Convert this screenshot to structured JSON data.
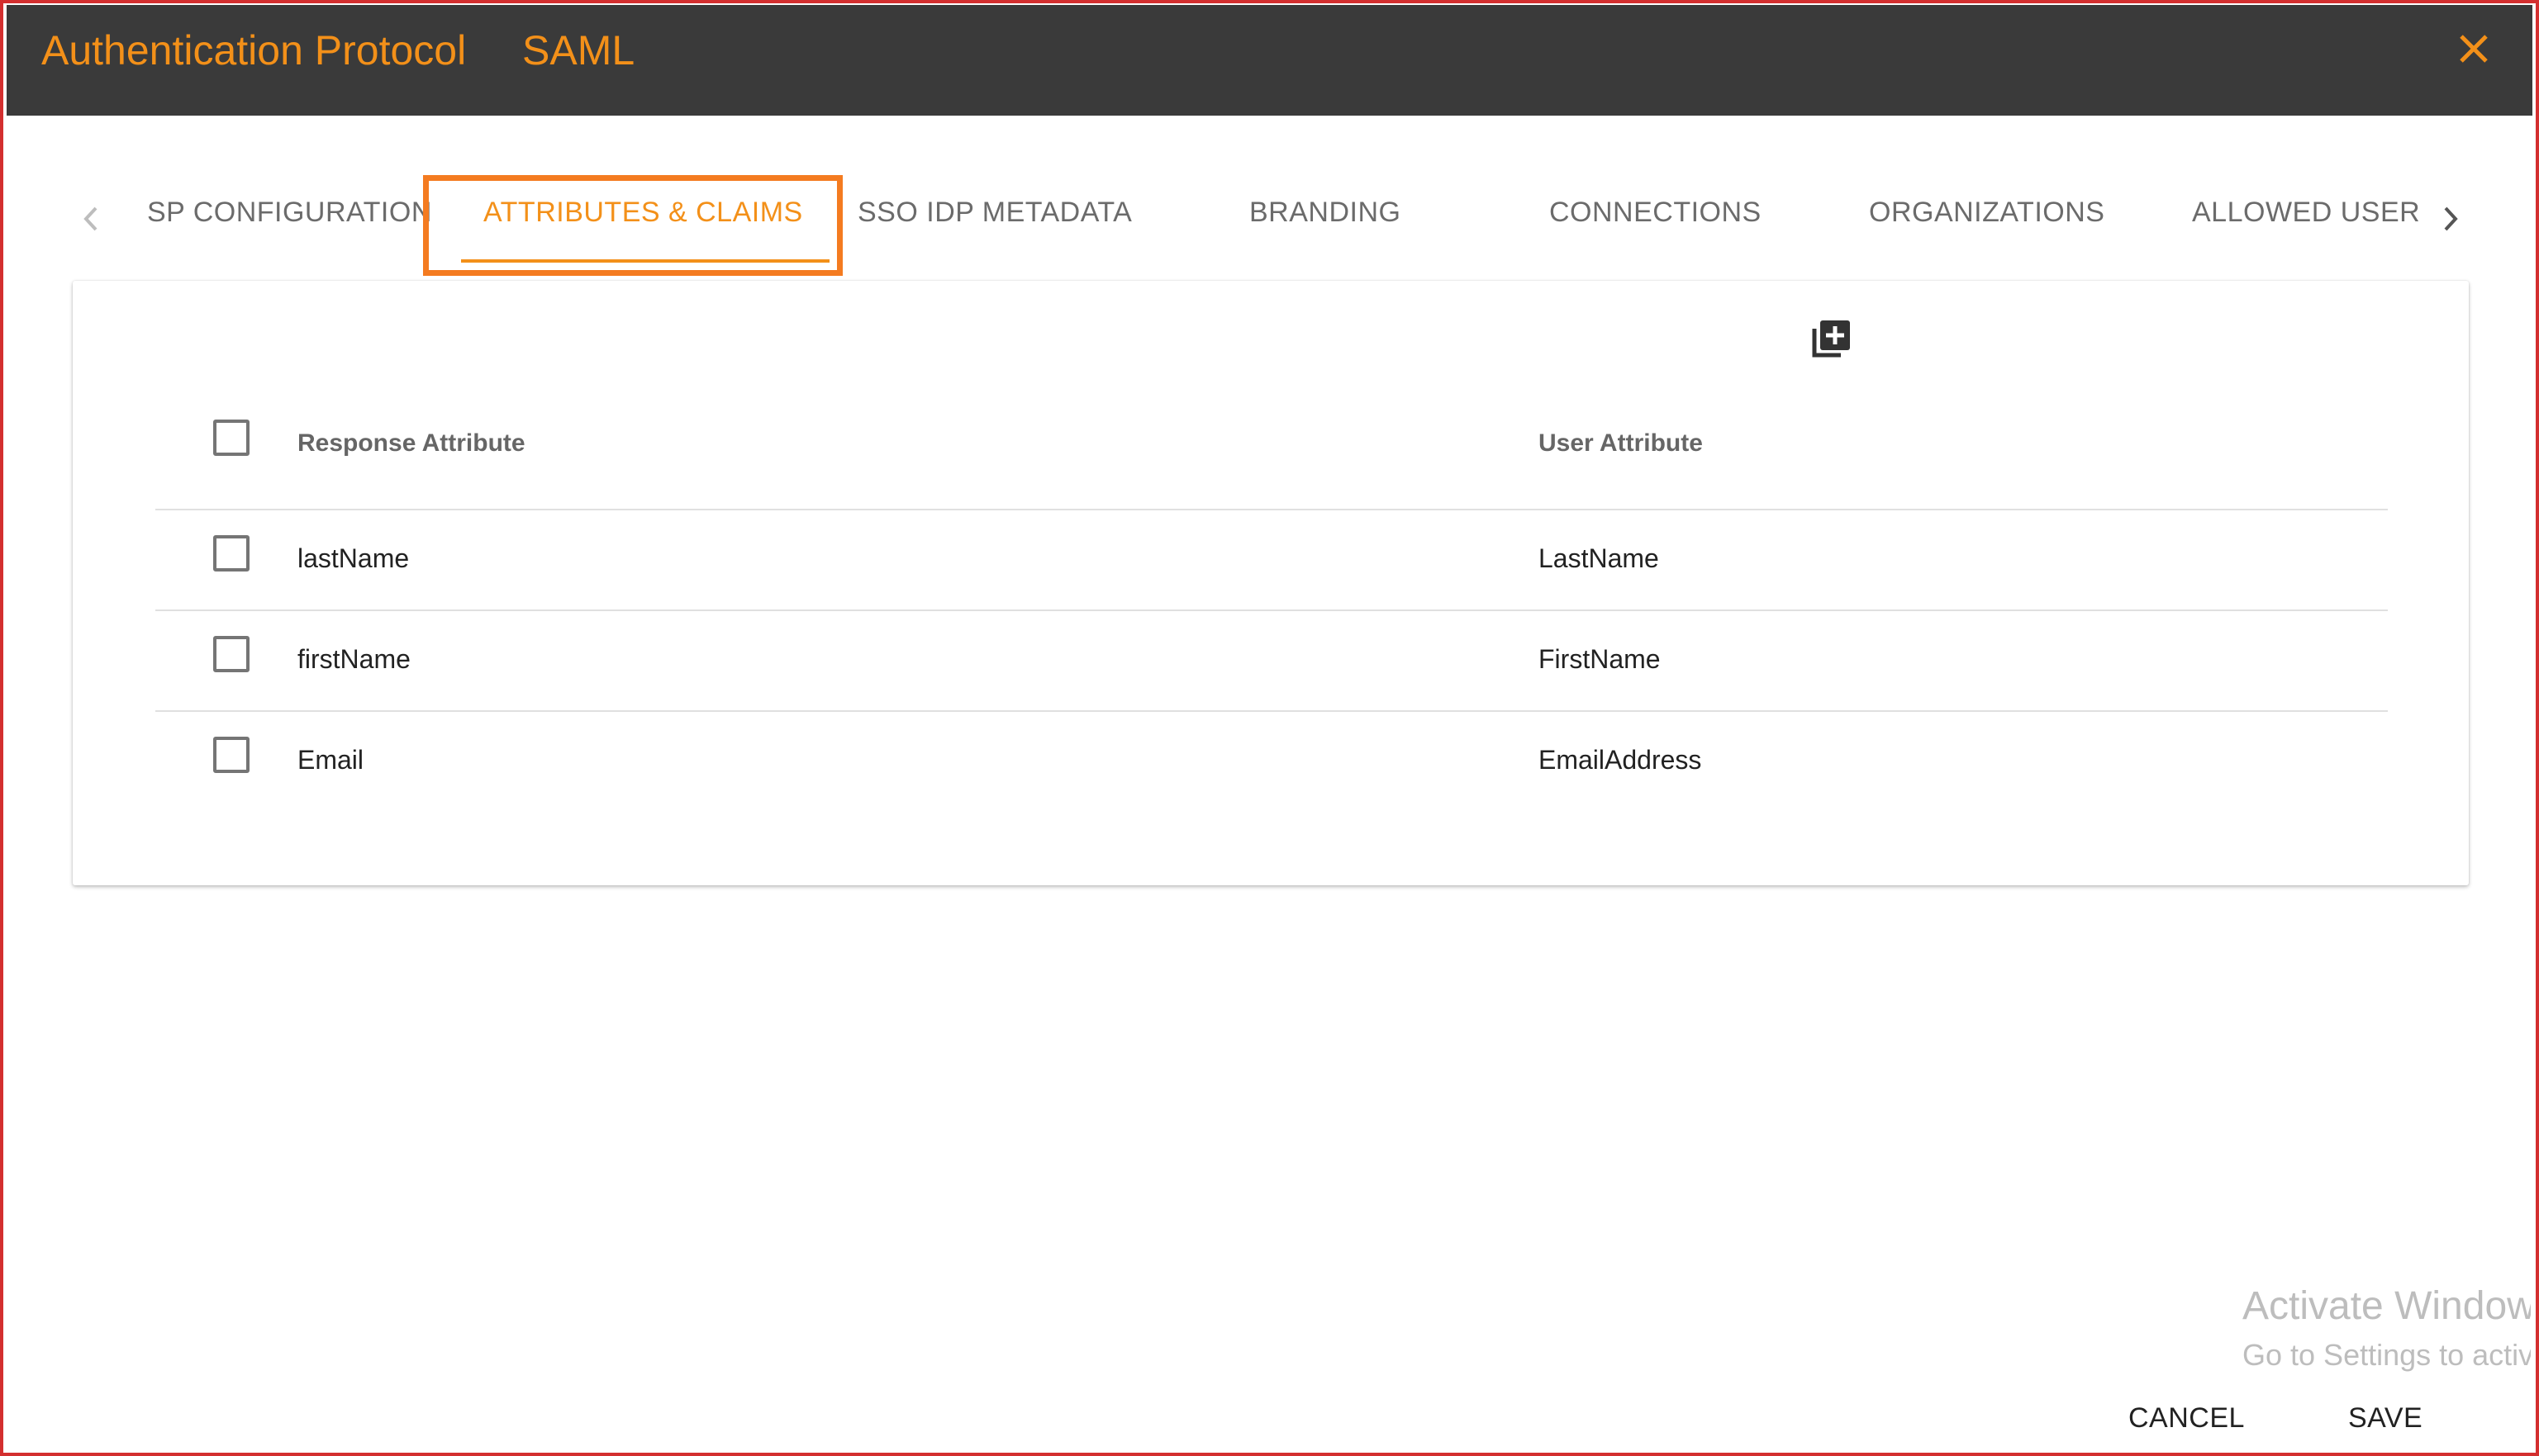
{
  "dialog": {
    "title": "Authentication Protocol",
    "protocol": "SAML",
    "accent_color": "#f39019",
    "close_icon": "close-icon"
  },
  "tabs": [
    {
      "label": "SP CONFIGURATION",
      "active": false
    },
    {
      "label": "ATTRIBUTES & CLAIMS",
      "active": true
    },
    {
      "label": "SSO IDP METADATA",
      "active": false
    },
    {
      "label": "BRANDING",
      "active": false
    },
    {
      "label": "CONNECTIONS",
      "active": false
    },
    {
      "label": "ORGANIZATIONS",
      "active": false
    },
    {
      "label": "ALLOWED USER",
      "active": false
    }
  ],
  "table": {
    "add_icon": "library-add-icon",
    "headers": {
      "response_attribute": "Response Attribute",
      "user_attribute": "User Attribute"
    },
    "rows": [
      {
        "response": "lastName",
        "user": "LastName"
      },
      {
        "response": "firstName",
        "user": "FirstName"
      },
      {
        "response": "Email",
        "user": "EmailAddress"
      }
    ]
  },
  "watermark": {
    "line1": "Activate Windows",
    "line2": "Go to Settings to activate Windows."
  },
  "footer": {
    "cancel_label": "CANCEL",
    "save_label": "SAVE"
  }
}
